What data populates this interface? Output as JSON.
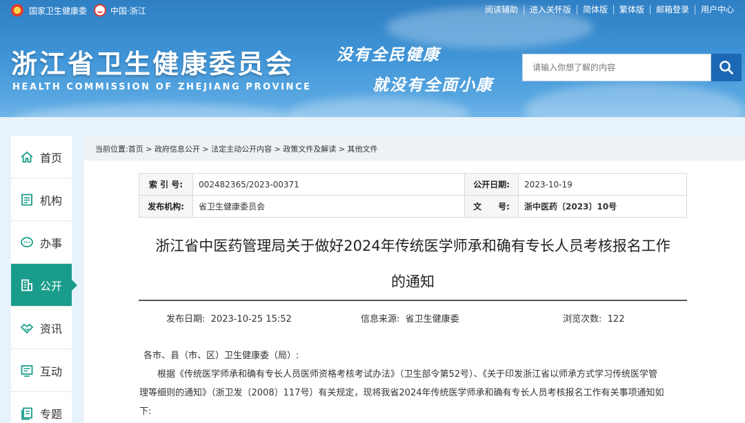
{
  "topbar": {
    "gov_label": "国家卫生健康委",
    "zj_label": "中国·浙江",
    "links": [
      "阅读辅助",
      "进入关怀版",
      "简体版",
      "繁体版",
      "邮箱登录",
      "用户中心"
    ]
  },
  "header": {
    "title": "浙江省卫生健康委员会",
    "subtitle": "HEALTH COMMISSION OF ZHEJIANG PROVINCE",
    "slogan_line1": "没有全民健康",
    "slogan_line2": "就没有全面小康"
  },
  "search": {
    "placeholder": "请输入你想了解的内容"
  },
  "sidebar": {
    "items": [
      {
        "label": "首页",
        "icon": "home-icon"
      },
      {
        "label": "机构",
        "icon": "building-doc-icon"
      },
      {
        "label": "办事",
        "icon": "chat-bubble-icon"
      },
      {
        "label": "公开",
        "icon": "building-icon",
        "active": true
      },
      {
        "label": "资讯",
        "icon": "handshake-icon"
      },
      {
        "label": "互动",
        "icon": "interaction-icon"
      },
      {
        "label": "专题",
        "icon": "topic-icon"
      }
    ]
  },
  "breadcrumb": {
    "prefix": "当前位置:",
    "items": [
      "首页",
      "政府信息公开",
      "法定主动公开内容",
      "政策文件及解读",
      "其他文件"
    ],
    "separator": " > "
  },
  "meta": {
    "index_label": "索 引 号:",
    "index_value": "002482365/2023-00371",
    "publish_date_label": "公开日期:",
    "publish_date_value": "2023-10-19",
    "issuer_label": "发布机构:",
    "issuer_value": "省卫生健康委员会",
    "doc_no_label": "文　　号:",
    "doc_no_value": "浙中医药〔2023〕10号"
  },
  "article": {
    "title_line1": "浙江省中医药管理局关于做好2024年传统医学师承和确有专长人员考核报名工作",
    "title_line2": "的通知",
    "release_date_label": "发布日期:",
    "release_date_value": "2023-10-25 15:52",
    "source_label": "信息来源:",
    "source_value": "省卫生健康委",
    "views_label": "浏览次数:",
    "views_value": "122",
    "salutation": "各市、县（市、区）卫生健康委（局）:",
    "para1_line1": "根据《传统医学师承和确有专长人员医师资格考核考试办法》（卫生部令第52号）、《关于印发浙江省以师承方式学习传统医学管",
    "para1_line2": "理等细则的通知》（浙卫发〔2008〕117号）有关规定，现将我省2024年传统医学师承和确有专长人员考核报名工作有关事项通知如",
    "para1_line3": "下:"
  }
}
